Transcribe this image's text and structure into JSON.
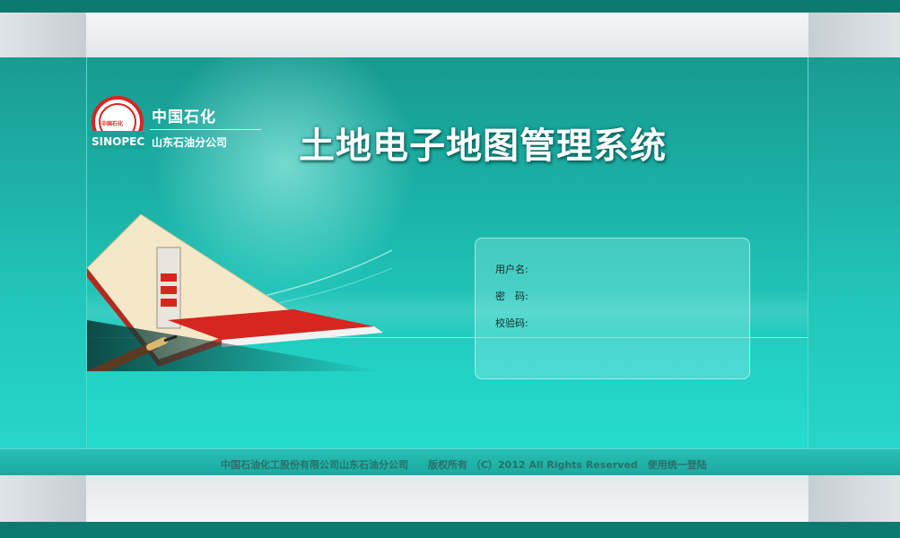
{
  "brand": {
    "company_cn": "中国石化",
    "company_sub": "山东石油分公司",
    "logo_text": "SINOPEC",
    "logo_badge": "中国石化"
  },
  "app": {
    "title": "土地电子地图管理系统"
  },
  "login": {
    "username_label": "用户名:",
    "password_label": "密　码:",
    "captcha_label": "校验码:",
    "username_value": "",
    "password_value": "",
    "captcha_value": ""
  },
  "footer": {
    "copyright": "中国石油化工股份有限公司山东石油分公司　　版权所有 （C）2012 All Rights Reserved　使用统一登陆"
  },
  "colors": {
    "accent_teal": "#1cb6aa",
    "dark_teal": "#0c7a71",
    "logo_red": "#d7261f"
  }
}
